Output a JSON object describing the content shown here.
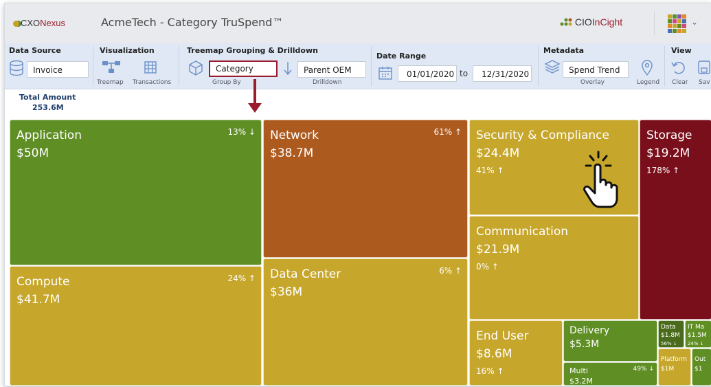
{
  "header": {
    "logo_text_a": "CXO",
    "logo_text_b": "Nexus",
    "title": "AcmeTech - Category TruSpend™",
    "brand_a": "CIO",
    "brand_b": "InCight"
  },
  "toolbar": {
    "data_source": {
      "title": "Data Source",
      "value": "Invoice"
    },
    "visualization": {
      "title": "Visualization",
      "treemap_label": "Treemap",
      "transactions_label": "Transactions"
    },
    "grouping": {
      "title": "Treemap Grouping & Drilldown",
      "group_by_value": "Category",
      "group_by_caption": "Group By",
      "drilldown_value": "Parent OEM",
      "drilldown_caption": "Drilldown"
    },
    "date_range": {
      "title": "Date Range",
      "from": "01/01/2020",
      "to_label": "to",
      "to": "12/31/2020"
    },
    "metadata": {
      "title": "Metadata",
      "overlay_value": "Spend Trend",
      "overlay_caption": "Overlay",
      "legend_caption": "Legend"
    },
    "view": {
      "title": "View",
      "clear_label": "Clear",
      "save_label": "Sav"
    }
  },
  "summary": {
    "label": "Total Amount",
    "value": "253.6M"
  },
  "colors": {
    "accent": "#9b1c2c",
    "green": "#5f8e24",
    "orange": "#ad5a1f",
    "gold": "#c6a62b",
    "maroon": "#7a0f1c",
    "darkgreen": "#4b6b1c"
  },
  "tiles": [
    {
      "name": "Application",
      "value": "$50M",
      "pct": "13% ↓"
    },
    {
      "name": "Network",
      "value": "$38.7M",
      "pct": "61% ↑"
    },
    {
      "name": "Security & Compliance",
      "value": "$24.4M",
      "pct": "41% ↑"
    },
    {
      "name": "Storage",
      "value": "$19.2M",
      "pct": "178% ↑"
    },
    {
      "name": "Communication",
      "value": "$21.9M",
      "pct": "0% ↑"
    },
    {
      "name": "Compute",
      "value": "$41.7M",
      "pct": "24% ↑"
    },
    {
      "name": "Data Center",
      "value": "$36M",
      "pct": "6% ↑"
    },
    {
      "name": "End User",
      "value": "$8.6M",
      "pct": "16% ↑"
    },
    {
      "name": "Delivery",
      "value": "$5.3M",
      "pct": ""
    },
    {
      "name": "Multi",
      "value": "$3.2M",
      "pct": "49% ↓"
    },
    {
      "name": "Data",
      "value": "$1.8M",
      "pct": "56% ↓"
    },
    {
      "name": "IT Ma",
      "value": "$1.5M",
      "pct": "24% ↓"
    },
    {
      "name": "Platform",
      "value": "$1M",
      "pct": ""
    },
    {
      "name": "Out",
      "value": "$1",
      "pct": ""
    }
  ]
}
